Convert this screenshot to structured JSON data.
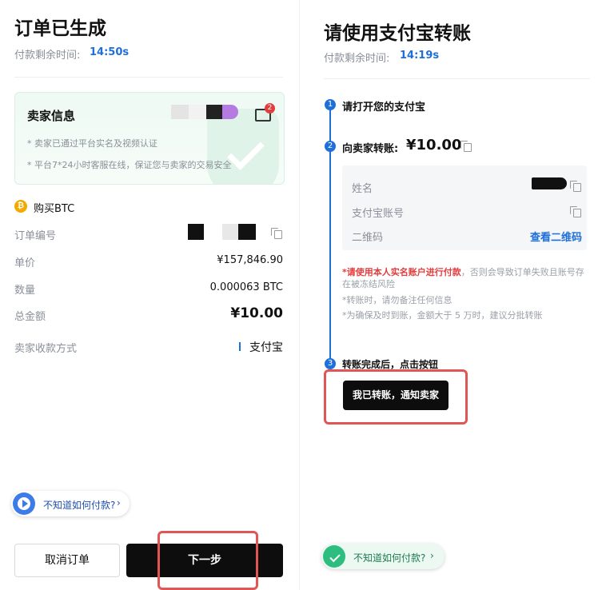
{
  "left": {
    "title": "订单已生成",
    "timer_label": "付款剩余时间:",
    "timer_value": "14:50s",
    "seller": {
      "heading": "卖家信息",
      "badge_count": "2",
      "notes": [
        "* 卖家已通过平台实名及视频认证",
        "* 平台7*24小时客服在线，保证您与卖家的交易安全"
      ]
    },
    "buy_label": "购买BTC",
    "rows": {
      "order_no_label": "订单编号",
      "price_label": "单价",
      "price_value": "¥157,846.90",
      "qty_label": "数量",
      "qty_value": "0.000063 BTC",
      "total_label": "总金额",
      "total_value": "¥10.00",
      "method_label": "卖家收款方式",
      "method_value": "支付宝"
    },
    "help_text": "不知道如何付款?",
    "cancel_label": "取消订单",
    "next_label": "下一步"
  },
  "right": {
    "title": "请使用支付宝转账",
    "timer_label": "付款剩余时间:",
    "timer_value": "14:19s",
    "steps": [
      {
        "num": "1",
        "text": "请打开您的支付宝"
      },
      {
        "num": "2",
        "text": "向卖家转账:",
        "amount": "¥10.00"
      },
      {
        "num": "3",
        "text": "转账完成后，点击按钮"
      }
    ],
    "info": {
      "name_label": "姓名",
      "account_label": "支付宝账号",
      "qr_label": "二维码",
      "qr_link": "查看二维码"
    },
    "notes": {
      "n1_red": "请使用本人实名账户进行付款",
      "n1_rest": "，否则会导致订单失败且账号存在被冻结风险",
      "n2": "转账时，请勿备注任何信息",
      "n3": "为确保及时到账，金额大于 5 万时，建议分批转账"
    },
    "confirm_label": "我已转账，通知卖家",
    "help_text": "不知道如何付款?"
  },
  "colors": {
    "accent": "#1e6fd9",
    "danger": "#e23c3c",
    "highlight": "#e25555",
    "success": "#2dbd7e"
  }
}
